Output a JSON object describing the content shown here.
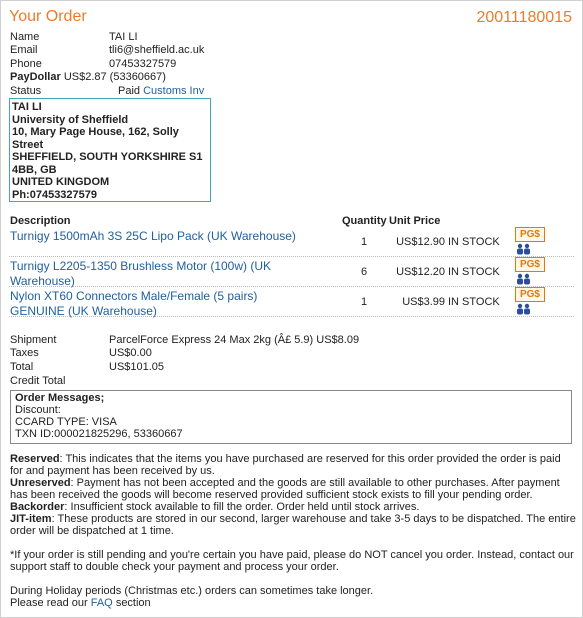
{
  "header": {
    "title": "Your Order",
    "order_number": "20011180015"
  },
  "customer": {
    "name_label": "Name",
    "name": "TAI LI",
    "email_label": "Email",
    "email": "tli6@sheffield.ac.uk",
    "phone_label": "Phone",
    "phone": "07453327579",
    "paydollar_label": "PayDollar",
    "paydollar": "US$2.87 (53360667)",
    "status_label": "Status",
    "status": "Paid",
    "status_link": "Customs Inv"
  },
  "address": {
    "lines": [
      "TAI LI",
      "University of Sheffield",
      "10, Mary Page House, 162, Solly",
      "Street",
      "SHEFFIELD, SOUTH YORKSHIRE S1",
      "4BB, GB",
      "UNITED KINGDOM",
      "Ph:07453327579"
    ]
  },
  "table": {
    "headers": {
      "description": "Description",
      "quantity": "Quantity",
      "unit_price": "Unit Price"
    },
    "items": [
      {
        "description": "Turnigy 1500mAh 3S 25C Lipo Pack (UK Warehouse)",
        "quantity": "1",
        "unit_price": "US$12.90",
        "stock": "IN STOCK",
        "badge": "PG$",
        "icon": "people-icon"
      },
      {
        "description": "Turnigy L2205-1350 Brushless Motor (100w) (UK Warehouse)",
        "quantity": "6",
        "unit_price": "US$12.20",
        "stock": "IN STOCK",
        "badge": "PG$",
        "icon": "people-icon"
      },
      {
        "description": "Nylon XT60 Connectors Male/Female (5 pairs) GENUINE (UK Warehouse)",
        "quantity": "1",
        "unit_price": "US$3.99",
        "stock": "IN STOCK",
        "badge": "PG$",
        "icon": "people-icon"
      }
    ]
  },
  "totals": {
    "shipment_label": "Shipment",
    "shipment": "ParcelForce Express 24 Max 2kg (Â£ 5.9) US$8.09",
    "taxes_label": "Taxes",
    "taxes": "US$0.00",
    "total_label": "Total",
    "total": "US$101.05",
    "credit_label": "Credit Total"
  },
  "messages": {
    "heading": "Order Messages;",
    "lines": [
      "Discount:",
      "CCARD TYPE: VISA",
      "TXN ID:000021825296, 53360667"
    ]
  },
  "notes": {
    "reserved_term": "Reserved",
    "reserved_text": ": This indicates that the items you have purchased are reserved for this order provided the order is paid for and payment has been received by us.",
    "unreserved_term": "Unreserved",
    "unreserved_text": ": Payment has not been accepted and the goods are still available to other purchases. After payment has been received the goods will become reserved provided sufficient stock exists to fill your pending order.",
    "backorder_term": "Backorder",
    "backorder_text": ": Insufficient stock available to fill the order. Order held until stock arrives.",
    "jit_term": "JIT-item",
    "jit_text": ": These products are stored in our second, larger warehouse and take 3-5 days to be dispatched. The entire order will be dispatched at 1 time.",
    "pending_text": "*If your order is still pending and you're certain you have paid, please do NOT cancel you order. Instead, contact our support staff to double check your payment and process your order.",
    "holiday_text": "During Holiday periods (Christmas etc.) orders can sometimes take longer.",
    "faq_prefix": "Please read our",
    "faq_link": "FAQ",
    "faq_suffix": "section"
  },
  "colors": {
    "accent": "#f07a2a",
    "link": "#2060a0",
    "address_border": "#4aa3b8",
    "badge": "#e07a10"
  }
}
